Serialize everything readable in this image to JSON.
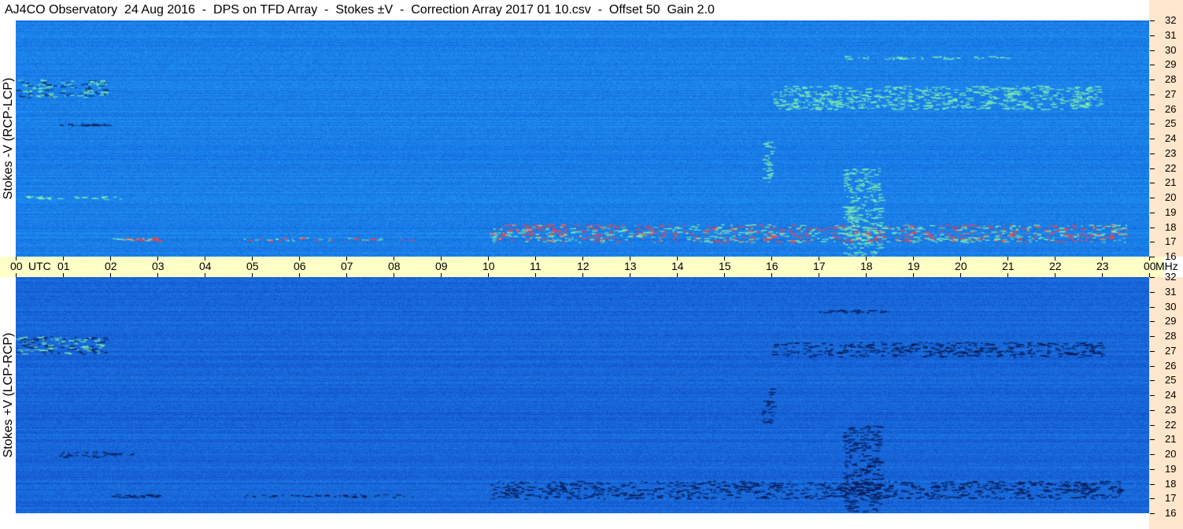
{
  "title": "AJ4CO Observatory  24 Aug 2016  -  DPS on TFD Array  -  Stokes ±V  -  Correction Array 2017 01 10.csv  -  Offset 50  Gain 2.0",
  "chart_data": [
    {
      "type": "heatmap",
      "panel": "top",
      "ylabel": "Stokes -V (RCP-LCP)",
      "x_axis": {
        "unit": "UTC",
        "range": [
          0,
          24
        ]
      },
      "y_axis": {
        "unit": "MHz",
        "range": [
          16,
          32
        ]
      },
      "y_ticks": [
        "16",
        "17",
        "18",
        "19",
        "20",
        "21",
        "22",
        "23",
        "24",
        "25",
        "26",
        "27",
        "28",
        "29",
        "30",
        "31",
        "32"
      ],
      "colors": {
        "background": "#1a7fe8",
        "high": "#7ff0b0",
        "hot": "#ff4040",
        "low": "#0a2a6a"
      },
      "features": [
        {
          "x": [
            0.0,
            1.9
          ],
          "y": [
            26.8,
            28.0
          ],
          "level": "mixed"
        },
        {
          "x": [
            0.9,
            2.0
          ],
          "y": [
            25.0,
            25.0
          ],
          "level": "low"
        },
        {
          "x": [
            0.2,
            2.2
          ],
          "y": [
            19.9,
            20.1
          ],
          "level": "high"
        },
        {
          "x": [
            2.0,
            3.0
          ],
          "y": [
            17.1,
            17.3
          ],
          "level": "hot"
        },
        {
          "x": [
            4.8,
            8.4
          ],
          "y": [
            17.1,
            17.3
          ],
          "level": "hot"
        },
        {
          "x": [
            10.0,
            23.5
          ],
          "y": [
            17.0,
            18.2
          ],
          "level": "hot"
        },
        {
          "x": [
            15.8,
            16.0
          ],
          "y": [
            21.0,
            24.0
          ],
          "level": "high"
        },
        {
          "x": [
            17.5,
            18.3
          ],
          "y": [
            16.0,
            22.0
          ],
          "level": "high"
        },
        {
          "x": [
            16.0,
            23.0
          ],
          "y": [
            26.0,
            27.6
          ],
          "level": "high"
        },
        {
          "x": [
            17.0,
            21.0
          ],
          "y": [
            29.4,
            29.6
          ],
          "level": "high"
        }
      ]
    },
    {
      "type": "heatmap",
      "panel": "bottom",
      "ylabel": "Stokes +V (LCP-RCP)",
      "x_axis": {
        "unit": "UTC",
        "range": [
          0,
          24
        ]
      },
      "y_axis": {
        "unit": "MHz",
        "range": [
          16,
          32
        ]
      },
      "y_ticks": [
        "16",
        "17",
        "18",
        "19",
        "20",
        "21",
        "22",
        "23",
        "24",
        "25",
        "26",
        "27",
        "28",
        "29",
        "30",
        "31",
        "32"
      ],
      "colors": {
        "background": "#1866d8",
        "high": "#7ff0b0",
        "hot": "#ff4040",
        "low": "#051a55"
      },
      "features": [
        {
          "x": [
            0.0,
            1.9
          ],
          "y": [
            26.8,
            28.0
          ],
          "level": "mixed"
        },
        {
          "x": [
            0.9,
            2.5
          ],
          "y": [
            19.8,
            20.2
          ],
          "level": "low"
        },
        {
          "x": [
            2.0,
            3.0
          ],
          "y": [
            17.1,
            17.3
          ],
          "level": "low"
        },
        {
          "x": [
            4.8,
            8.4
          ],
          "y": [
            17.1,
            17.3
          ],
          "level": "low"
        },
        {
          "x": [
            10.0,
            23.5
          ],
          "y": [
            17.0,
            18.2
          ],
          "level": "low"
        },
        {
          "x": [
            15.8,
            16.0
          ],
          "y": [
            22.0,
            24.5
          ],
          "level": "low"
        },
        {
          "x": [
            17.5,
            18.3
          ],
          "y": [
            16.0,
            22.0
          ],
          "level": "low"
        },
        {
          "x": [
            16.0,
            23.0
          ],
          "y": [
            26.6,
            27.6
          ],
          "level": "low"
        },
        {
          "x": [
            17.0,
            18.5
          ],
          "y": [
            29.6,
            29.8
          ],
          "level": "low"
        }
      ]
    }
  ],
  "time_axis": {
    "ticks": [
      "00",
      "01",
      "02",
      "03",
      "04",
      "05",
      "06",
      "07",
      "08",
      "09",
      "10",
      "11",
      "12",
      "13",
      "14",
      "15",
      "16",
      "17",
      "18",
      "19",
      "20",
      "21",
      "22",
      "23",
      "00"
    ],
    "utc_label": "UTC",
    "freq_unit": "MHz"
  }
}
